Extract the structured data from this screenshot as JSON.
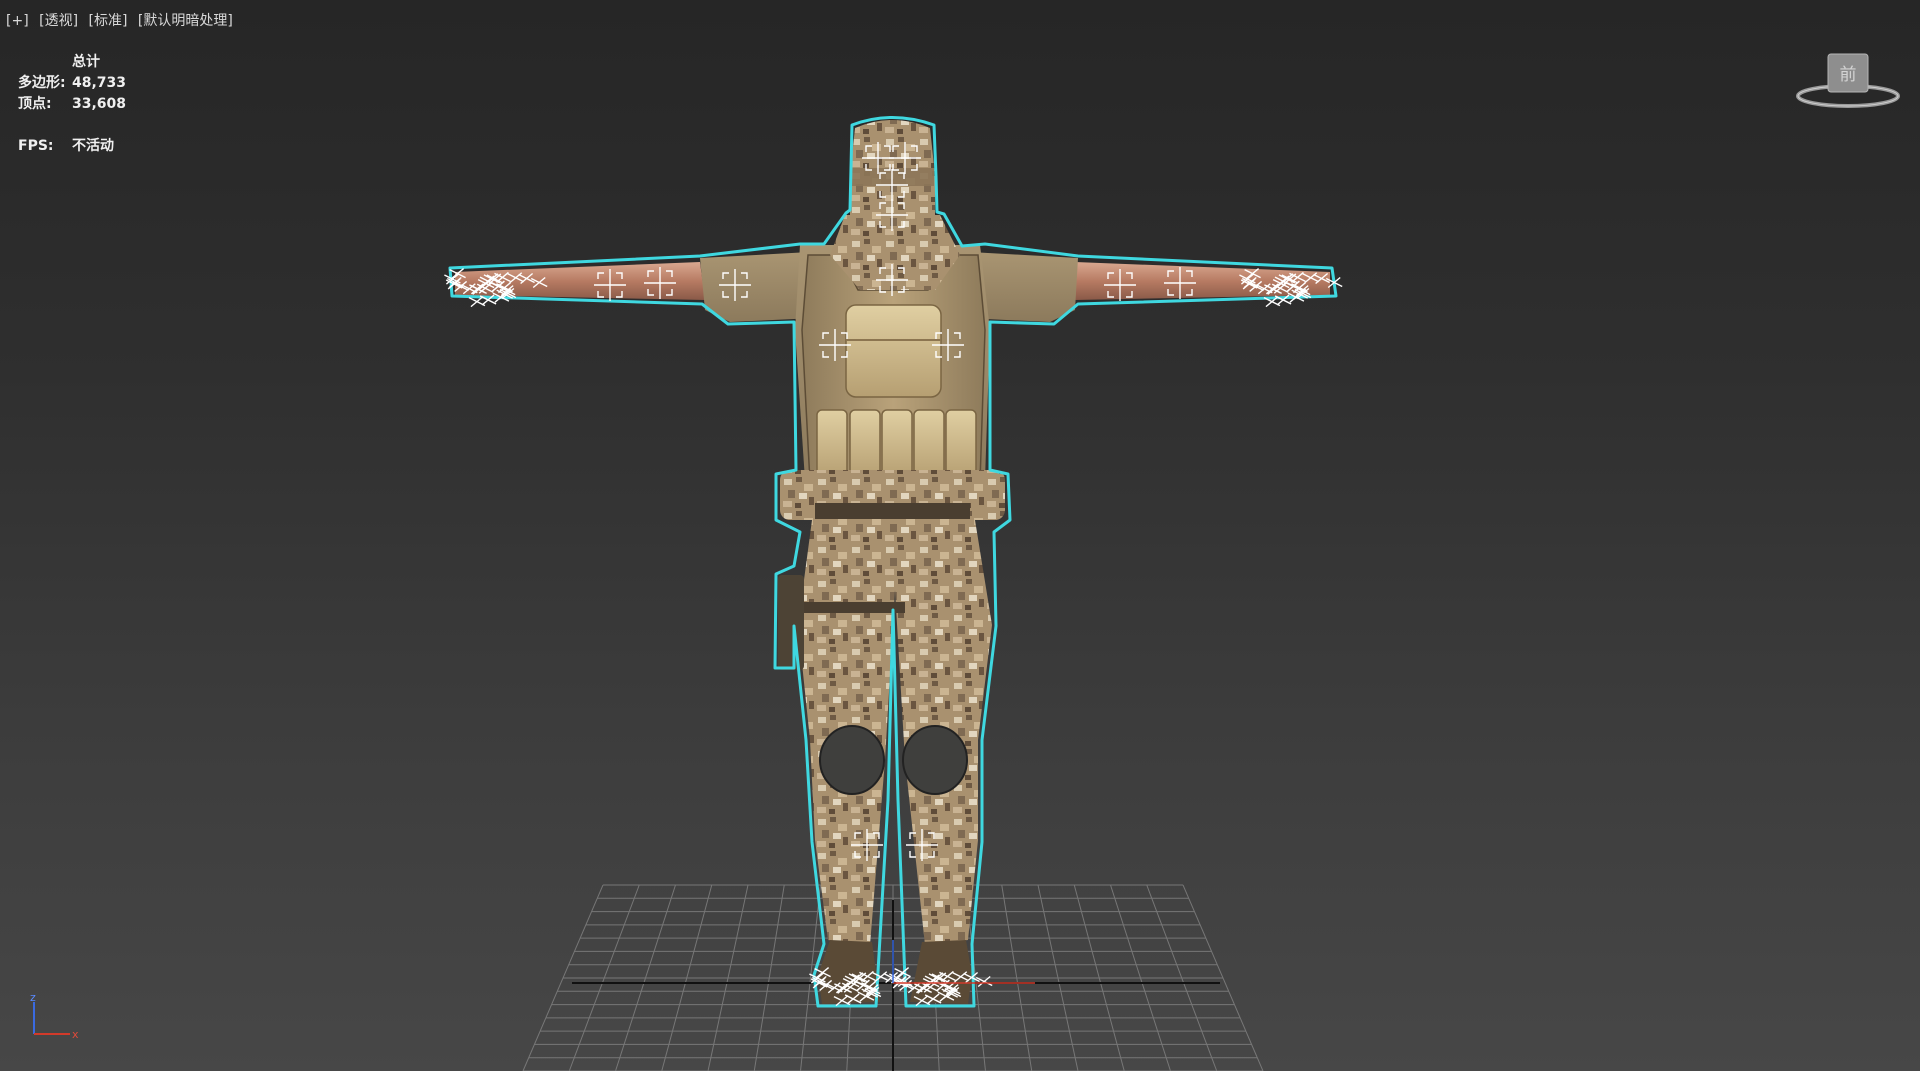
{
  "viewport": {
    "labels": [
      "[+]",
      "[透视]",
      "[标准]",
      "[默认明暗处理]"
    ]
  },
  "stats": {
    "header": "总计",
    "polys_label": "多边形:",
    "polys_value": "48,733",
    "verts_label": "顶点:",
    "verts_value": "33,608",
    "fps_label": "FPS:",
    "fps_value": "不活动"
  },
  "viewcube": {
    "face_label": "前"
  },
  "axis": {
    "z_label": "z",
    "x_label": "x"
  },
  "colors": {
    "selection_outline": "#3fd8e0",
    "camo_base": "#a08a6a",
    "grid": "#8a8a8a",
    "axis_x": "#d23a2a",
    "axis_z": "#3a6ae0"
  }
}
